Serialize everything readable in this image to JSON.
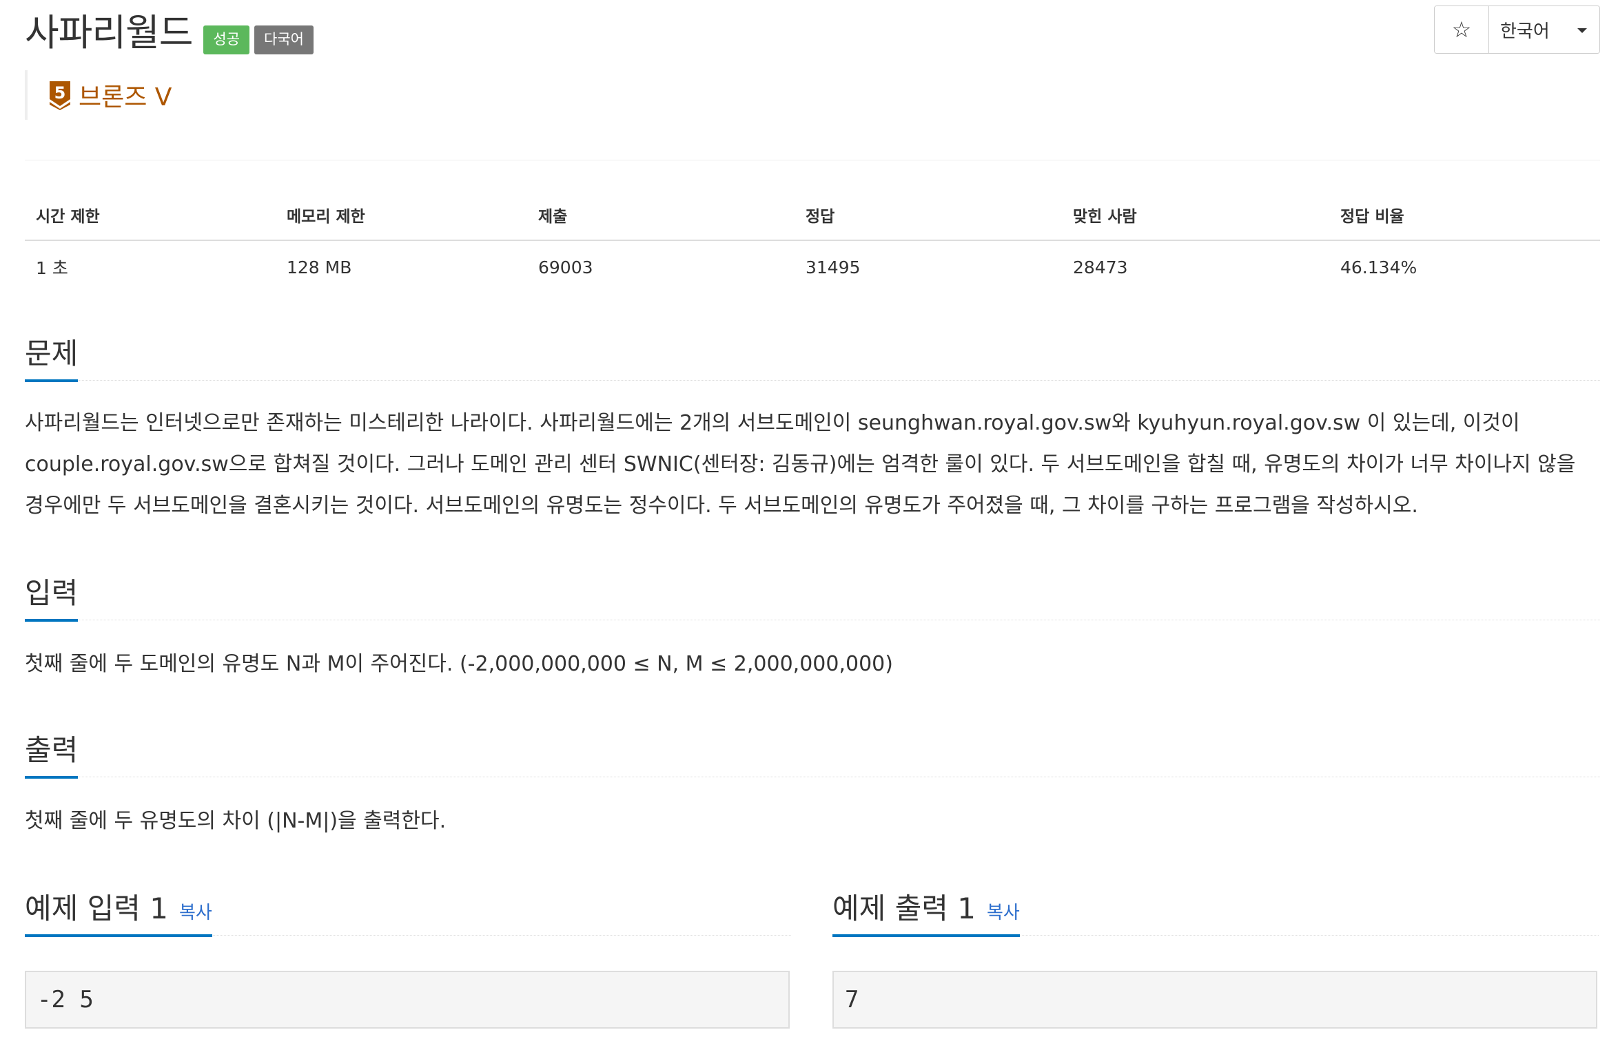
{
  "problem": {
    "title": "사파리월드",
    "labels": {
      "success": "성공",
      "multilang": "다국어"
    },
    "tier": "브론즈 V",
    "tier_number": "5"
  },
  "toolbar": {
    "star_glyph": "☆",
    "language": "한국어"
  },
  "info": {
    "headers": [
      "시간 제한",
      "메모리 제한",
      "제출",
      "정답",
      "맞힌 사람",
      "정답 비율"
    ],
    "values": [
      "1 초",
      "128 MB",
      "69003",
      "31495",
      "28473",
      "46.134%"
    ]
  },
  "sections": {
    "description": {
      "heading": "문제",
      "text": "사파리월드는 인터넷으로만 존재하는 미스테리한 나라이다. 사파리월드에는 2개의 서브도메인이 seunghwan.royal.gov.sw와 kyuhyun.royal.gov.sw 이 있는데, 이것이 couple.royal.gov.sw으로 합쳐질 것이다. 그러나 도메인 관리 센터 SWNIC(센터장: 김동규)에는 엄격한 룰이 있다. 두 서브도메인을 합칠 때, 유명도의 차이가 너무 차이나지 않을 경우에만 두 서브도메인을 결혼시키는 것이다. 서브도메인의 유명도는 정수이다. 두 서브도메인의 유명도가 주어졌을 때, 그 차이를 구하는 프로그램을 작성하시오."
    },
    "input": {
      "heading": "입력",
      "text": "첫째 줄에 두 도메인의 유명도 N과 M이 주어진다. (-2,000,000,000 ≤ N, M ≤ 2,000,000,000)"
    },
    "output": {
      "heading": "출력",
      "text": "첫째 줄에 두 유명도의 차이 (|N-M|)을 출력한다."
    }
  },
  "samples": {
    "input": {
      "heading": "예제 입력 1",
      "copy": "복사",
      "content": "-2 5"
    },
    "output": {
      "heading": "예제 출력 1",
      "copy": "복사",
      "content": "7"
    }
  },
  "colors": {
    "success": "#5cb85c",
    "default_label": "#777777",
    "bronze": "#ad5600",
    "accent": "#0076c0",
    "link": "#2e6fcd"
  },
  "icons": {
    "star": "star-icon",
    "caret": "caret-down-icon",
    "tier": "bronze-tier-icon"
  }
}
